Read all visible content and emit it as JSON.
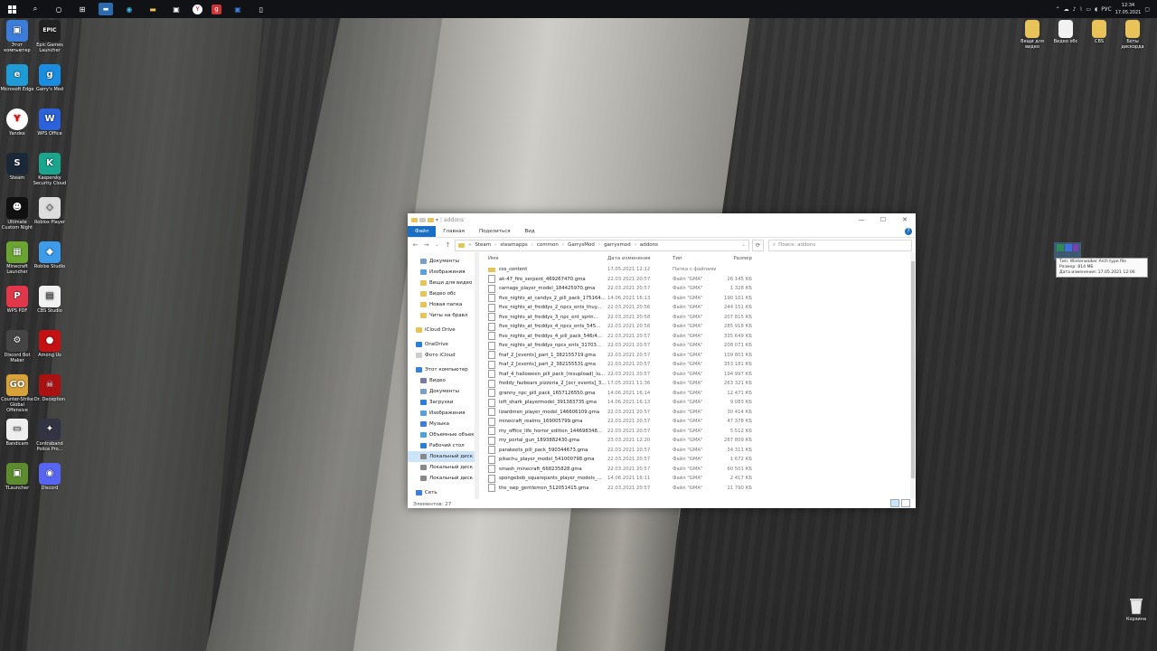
{
  "taskbar": {
    "lang": "РУС",
    "time": "12:34",
    "date": "17.05.2021"
  },
  "desktop_left": [
    {
      "label": "Этот компьютер",
      "icon": "computer-icon",
      "color": "#3b7dd8"
    },
    {
      "label": "Epic Games Launcher",
      "icon": "epic-games-icon",
      "color": "#222222",
      "glyph": "EPIC"
    },
    {
      "label": "Microsoft Edge",
      "icon": "edge-icon",
      "color": "#1f9bd6",
      "glyph": "e"
    },
    {
      "label": "Garry's Mod",
      "icon": "garrys-mod-icon",
      "color": "#1a8de0",
      "glyph": "g"
    },
    {
      "label": "Yandex",
      "icon": "yandex-icon",
      "color": "#ffffff",
      "glyph": "Y"
    },
    {
      "label": "WPS Office",
      "icon": "wps-icon",
      "color": "#2b62d9",
      "glyph": "W"
    },
    {
      "label": "Steam",
      "icon": "steam-icon",
      "color": "#1b2838",
      "glyph": "S"
    },
    {
      "label": "Kaspersky Security Cloud",
      "icon": "kaspersky-icon",
      "color": "#1aa68e",
      "glyph": "K"
    },
    {
      "label": "Ultimate Custom Night",
      "icon": "game-icon",
      "color": "#111111",
      "glyph": "☻"
    },
    {
      "label": "Roblox Player",
      "icon": "roblox-icon",
      "color": "#dddddd",
      "glyph": "◇"
    },
    {
      "label": "Minecraft Launcher",
      "icon": "minecraft-icon",
      "color": "#6aa531",
      "glyph": "▦"
    },
    {
      "label": "Roblox Studio",
      "icon": "roblox-studio-icon",
      "color": "#3d9be9",
      "glyph": "◆"
    },
    {
      "label": "WPS PDF",
      "icon": "wps-pdf-icon",
      "color": "#e0384a",
      "glyph": "P"
    },
    {
      "label": "CBS Studio",
      "icon": "document-icon",
      "color": "#f2f2f2",
      "glyph": "▤"
    },
    {
      "label": "Discord Bot Maker",
      "icon": "bot-maker-icon",
      "color": "#444444",
      "glyph": "⚙"
    },
    {
      "label": "Among Us",
      "icon": "among-us-icon",
      "color": "#c51111",
      "glyph": "●"
    },
    {
      "label": "Counter-Strike Global Offensive",
      "icon": "csgo-icon",
      "color": "#d8a23a",
      "glyph": "GO"
    },
    {
      "label": "Dr. Deception",
      "icon": "deception-icon",
      "color": "#aa1111",
      "glyph": "☠"
    },
    {
      "label": "Bandicam",
      "icon": "bandicam-icon",
      "color": "#eeeeee",
      "glyph": "▭"
    },
    {
      "label": "Contraband Police Pro...",
      "icon": "police-icon",
      "color": "#333344",
      "glyph": "✦"
    },
    {
      "label": "TLauncher",
      "icon": "tlauncher-icon",
      "color": "#5d8c2f",
      "glyph": "▣"
    },
    {
      "label": "Discord",
      "icon": "discord-icon",
      "color": "#5865f2",
      "glyph": "◉"
    }
  ],
  "desktop_right": [
    {
      "label": "Вещи для видео",
      "icon": "folder-icon"
    },
    {
      "label": "Видео обс",
      "icon": "file-icon"
    },
    {
      "label": "CBS",
      "icon": "folder-icon"
    },
    {
      "label": "Боты дискорда",
      "icon": "folder-icon"
    }
  ],
  "recycle_bin": "Корзина",
  "tooltip": {
    "line1": "Тип: Winterwalker Arch type file",
    "line2": "Размер: 814 МБ",
    "line3": "Дата изменения: 17.05.2021 12:06"
  },
  "window": {
    "title": "addons",
    "ribbon": [
      "Файл",
      "Главная",
      "Поделиться",
      "Вид"
    ],
    "breadcrumb": [
      "Steam",
      "steamapps",
      "common",
      "GarrysMod",
      "garrysmod",
      "addons"
    ],
    "search_placeholder": "Поиск: addons",
    "columns": {
      "name": "Имя",
      "date": "Дата изменения",
      "type": "Тип",
      "size": "Размер"
    },
    "nav": [
      {
        "label": "Документы",
        "icon": "documents-icon",
        "color": "#7a9fc9"
      },
      {
        "label": "Изображения",
        "icon": "pictures-icon",
        "color": "#5aa0d8"
      },
      {
        "label": "Вещи для видео",
        "icon": "folder-icon",
        "color": "#e8c35a"
      },
      {
        "label": "Видео обс",
        "icon": "folder-icon",
        "color": "#e8c35a"
      },
      {
        "label": "Новая папка",
        "icon": "folder-icon",
        "color": "#e8c35a"
      },
      {
        "label": "Читы на бравл",
        "icon": "folder-icon",
        "color": "#e8c35a"
      },
      {
        "label": "iCloud Drive",
        "icon": "icloud-icon",
        "color": "#e8c35a",
        "top": true
      },
      {
        "label": "OneDrive",
        "icon": "onedrive-icon",
        "color": "#2b7fd4",
        "top": true
      },
      {
        "label": "Фото iCloud",
        "icon": "icloud-photos-icon",
        "color": "#cccccc",
        "top": true
      },
      {
        "label": "Этот компьютер",
        "icon": "computer-icon",
        "color": "#3b7dd8",
        "top": true
      },
      {
        "label": "Видео",
        "icon": "videos-icon",
        "color": "#7a7aa0"
      },
      {
        "label": "Документы",
        "icon": "documents-icon",
        "color": "#7a9fc9"
      },
      {
        "label": "Загрузки",
        "icon": "downloads-icon",
        "color": "#2b7fd4"
      },
      {
        "label": "Изображения",
        "icon": "pictures-icon",
        "color": "#5aa0d8"
      },
      {
        "label": "Музыка",
        "icon": "music-icon",
        "color": "#3b7dd8"
      },
      {
        "label": "Объемные объекты",
        "icon": "3d-objects-icon",
        "color": "#49a3d6"
      },
      {
        "label": "Рабочий стол",
        "icon": "desktop-icon",
        "color": "#2b7fd4"
      },
      {
        "label": "Локальный диск",
        "icon": "drive-icon",
        "color": "#888888",
        "selected": true
      },
      {
        "label": "Локальный диск",
        "icon": "drive-icon",
        "color": "#888888"
      },
      {
        "label": "Локальный диск",
        "icon": "drive-icon",
        "color": "#888888"
      },
      {
        "label": "Сеть",
        "icon": "network-icon",
        "color": "#3b7dd8",
        "top": true
      }
    ],
    "files": [
      {
        "name": "css_content",
        "date": "17.05.2021 12:12",
        "type": "Папка с файлами",
        "size": "",
        "folder": true
      },
      {
        "name": "ak-47_fire_serpent_469267470.gma",
        "date": "22.03.2021 20:57",
        "type": "Файл \"GMA\"",
        "size": "26 145 КБ"
      },
      {
        "name": "carnage_player_model_184425970.gma",
        "date": "22.03.2021 20:57",
        "type": "Файл \"GMA\"",
        "size": "1 328 КБ"
      },
      {
        "name": "five_nights_at_candys_2_pill_pack_175164...",
        "date": "14.06.2021 16:13",
        "type": "Файл \"GMA\"",
        "size": "190 101 КБ"
      },
      {
        "name": "five_nights_at_freddys_2_npcs_ents_thuy...",
        "date": "22.03.2021 20:56",
        "type": "Файл \"GMA\"",
        "size": "244 151 КБ"
      },
      {
        "name": "five_nights_at_freddys_3_npc_ent_sprin...",
        "date": "22.03.2021 20:58",
        "type": "Файл \"GMA\"",
        "size": "207 815 КБ"
      },
      {
        "name": "five_nights_at_freddys_4_npcs_ents_545...",
        "date": "22.03.2021 20:58",
        "type": "Файл \"GMA\"",
        "size": "285 918 КБ"
      },
      {
        "name": "five_nights_at_freddys_4_pill_pack_546/4...",
        "date": "22.03.2021 20:57",
        "type": "Файл \"GMA\"",
        "size": "335 649 КБ"
      },
      {
        "name": "five_nights_at_freddys_npcs_ents_31703...",
        "date": "22.03.2021 20:57",
        "type": "Файл \"GMA\"",
        "size": "208 071 КБ"
      },
      {
        "name": "fnaf_2_[events]_part_1_382155719.gma",
        "date": "22.03.2021 20:57",
        "type": "Файл \"GMA\"",
        "size": "109 801 КБ"
      },
      {
        "name": "fnaf_2_[events]_part_2_382155531.gma",
        "date": "22.03.2021 20:57",
        "type": "Файл \"GMA\"",
        "size": "353 181 КБ"
      },
      {
        "name": "fnaf_4_halloween_pill_pack_(resupload)_lu...",
        "date": "22.03.2021 20:57",
        "type": "Файл \"GMA\"",
        "size": "194 997 КБ"
      },
      {
        "name": "freddy_fazbears_pizzeria_2_[ocr_events]_3...",
        "date": "17.05.2021 11:36",
        "type": "Файл \"GMA\"",
        "size": "263 321 КБ"
      },
      {
        "name": "granny_npc_pill_pack_1657126550.gma",
        "date": "14.06.2021 16:14",
        "type": "Файл \"GMA\"",
        "size": "12 471 КБ"
      },
      {
        "name": "left_shark_playermodel_391383735.gma",
        "date": "14.06.2021 16:13",
        "type": "Файл \"GMA\"",
        "size": "9 083 КБ"
      },
      {
        "name": "lizardmen_player_model_146606109.gma",
        "date": "22.03.2021 20:57",
        "type": "Файл \"GMA\"",
        "size": "30 414 КБ"
      },
      {
        "name": "minecraft_realms_169005799.gma",
        "date": "22.03.2021 20:57",
        "type": "Файл \"GMA\"",
        "size": "47 378 КБ"
      },
      {
        "name": "my_office_life_horror_edition_144698348...",
        "date": "22.03.2021 20:57",
        "type": "Файл \"GMA\"",
        "size": "5 512 КБ"
      },
      {
        "name": "my_portal_gun_1893882430.gma",
        "date": "23.03.2021 12:20",
        "type": "Файл \"GMA\"",
        "size": "287 809 КБ"
      },
      {
        "name": "parakeets_pill_pack_590344673.gma",
        "date": "22.03.2021 20:57",
        "type": "Файл \"GMA\"",
        "size": "34 311 КБ"
      },
      {
        "name": "pikachu_player_model_541000798.gma",
        "date": "22.03.2021 20:57",
        "type": "Файл \"GMA\"",
        "size": "1 672 КБ"
      },
      {
        "name": "smash_minecraft_668235828.gma",
        "date": "22.03.2021 20:57",
        "type": "Файл \"GMA\"",
        "size": "60 501 КБ"
      },
      {
        "name": "spongebob_squarepants_player_models_...",
        "date": "14.06.2021 16:11",
        "type": "Файл \"GMA\"",
        "size": "2 417 КБ"
      },
      {
        "name": "the_swp_gentlemen_512051415.gma",
        "date": "22.03.2021 20:57",
        "type": "Файл \"GMA\"",
        "size": "11 790 КБ"
      }
    ],
    "status": "Элементов: 27"
  }
}
